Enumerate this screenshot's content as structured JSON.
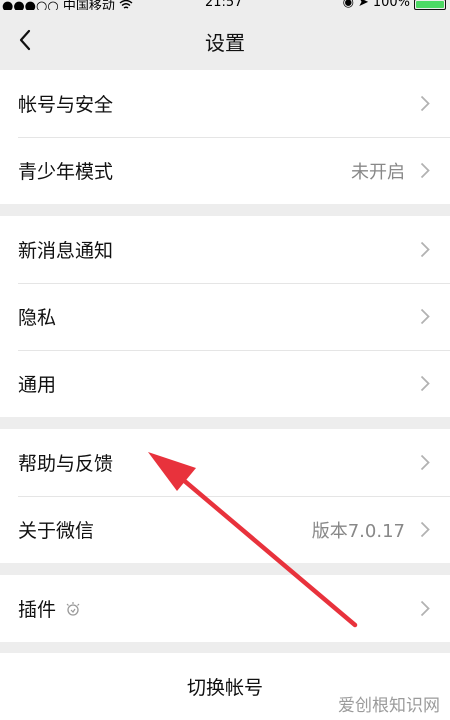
{
  "statusbar": {
    "carrier": "●●●○○ 中国移动",
    "time": "21:57",
    "battery": "100%"
  },
  "navbar": {
    "title": "设置"
  },
  "groups": [
    [
      {
        "label": "帐号与安全",
        "value": ""
      },
      {
        "label": "青少年模式",
        "value": "未开启"
      }
    ],
    [
      {
        "label": "新消息通知",
        "value": ""
      },
      {
        "label": "隐私",
        "value": ""
      },
      {
        "label": "通用",
        "value": ""
      }
    ],
    [
      {
        "label": "帮助与反馈",
        "value": ""
      },
      {
        "label": "关于微信",
        "value": "版本7.0.17"
      }
    ],
    [
      {
        "label": "插件",
        "value": ""
      }
    ]
  ],
  "switch_account": "切换帐号",
  "watermark": "爱创根知识网",
  "colors": {
    "arrow": "#e8323c",
    "background": "#ededed"
  }
}
